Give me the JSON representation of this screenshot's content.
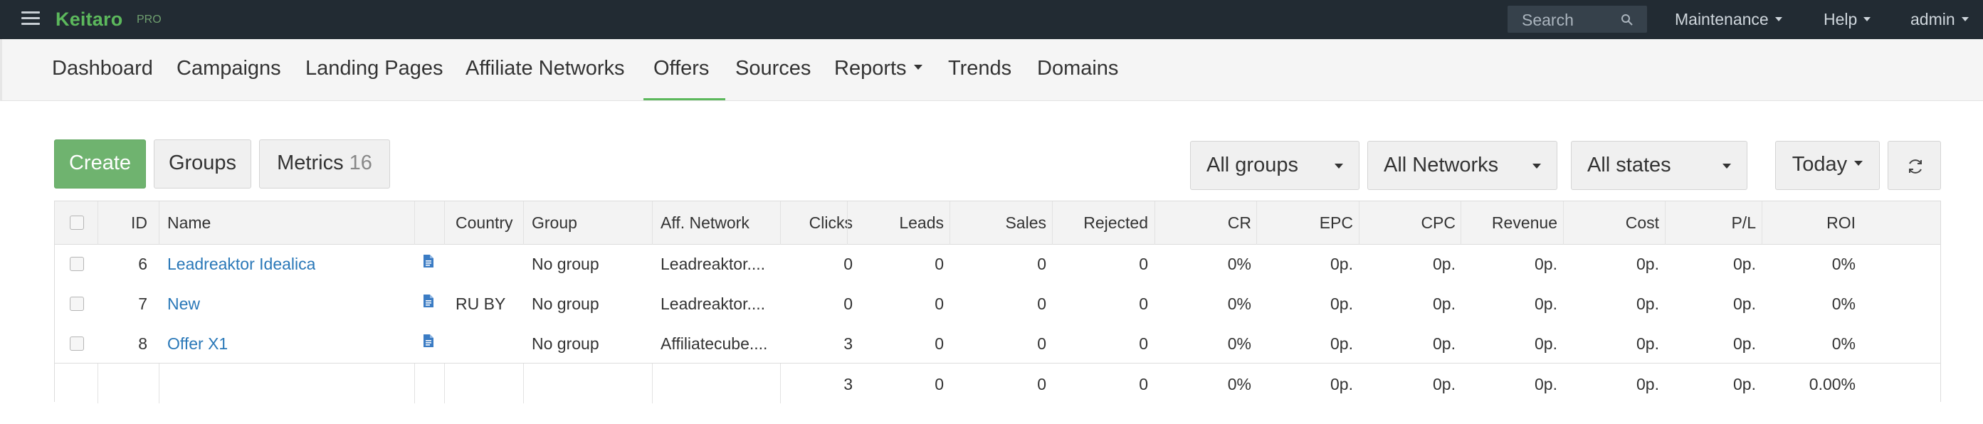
{
  "topbar": {
    "brand": "Keitaro",
    "brand_badge": "PRO",
    "search_placeholder": "Search",
    "maintenance": "Maintenance",
    "help": "Help",
    "user": "admin"
  },
  "nav": {
    "items": [
      "Dashboard",
      "Campaigns",
      "Landing Pages",
      "Affiliate Networks",
      "Offers",
      "Sources",
      "Reports",
      "Trends",
      "Domains"
    ],
    "active": "Offers"
  },
  "toolbar": {
    "create": "Create",
    "groups": "Groups",
    "metrics": "Metrics",
    "metrics_count": "16",
    "group_filter": "All groups",
    "network_filter": "All Networks",
    "state_filter": "All states",
    "period": "Today"
  },
  "table": {
    "headers": {
      "id": "ID",
      "name": "Name",
      "country": "Country",
      "group": "Group",
      "network": "Aff. Network",
      "clicks": "Clicks",
      "leads": "Leads",
      "sales": "Sales",
      "rejected": "Rejected",
      "cr": "CR",
      "epc": "EPC",
      "cpc": "CPC",
      "revenue": "Revenue",
      "cost": "Cost",
      "pl": "P/L",
      "roi": "ROI"
    },
    "rows": [
      {
        "id": "6",
        "name": "Leadreaktor Idealica",
        "country": "",
        "group": "No group",
        "network": "Leadreaktor....",
        "clicks": "0",
        "leads": "0",
        "sales": "0",
        "rejected": "0",
        "cr": "0%",
        "epc": "0p.",
        "cpc": "0p.",
        "revenue": "0p.",
        "cost": "0p.",
        "pl": "0p.",
        "roi": "0%"
      },
      {
        "id": "7",
        "name": "New",
        "country": "RU BY",
        "group": "No group",
        "network": "Leadreaktor....",
        "clicks": "0",
        "leads": "0",
        "sales": "0",
        "rejected": "0",
        "cr": "0%",
        "epc": "0p.",
        "cpc": "0p.",
        "revenue": "0p.",
        "cost": "0p.",
        "pl": "0p.",
        "roi": "0%"
      },
      {
        "id": "8",
        "name": "Offer X1",
        "country": "",
        "group": "No group",
        "network": "Affiliatecube....",
        "clicks": "3",
        "leads": "0",
        "sales": "0",
        "rejected": "0",
        "cr": "0%",
        "epc": "0p.",
        "cpc": "0p.",
        "revenue": "0p.",
        "cost": "0p.",
        "pl": "0p.",
        "roi": "0%"
      }
    ],
    "totals": {
      "clicks": "3",
      "leads": "0",
      "sales": "0",
      "rejected": "0",
      "cr": "0%",
      "epc": "0p.",
      "cpc": "0p.",
      "revenue": "0p.",
      "cost": "0p.",
      "pl": "0p.",
      "roi": "0.00%"
    }
  },
  "icons": {
    "menu": "hamburger-icon",
    "search": "search-icon",
    "refresh": "refresh-icon",
    "offer_doc": "document-icon"
  },
  "colors": {
    "topbar": "#222b33",
    "brand": "#5cb85c",
    "create_button": "#6fb36f",
    "link": "#2a78b8",
    "active_tab": "#5cb85c"
  }
}
